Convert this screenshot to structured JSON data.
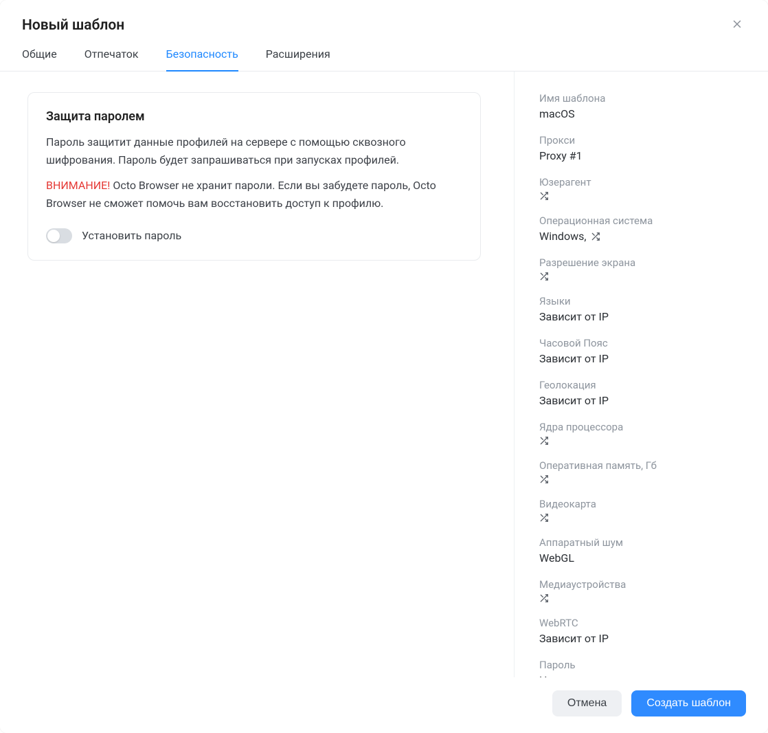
{
  "header": {
    "title": "Новый шаблон"
  },
  "tabs": [
    {
      "label": "Общие",
      "active": false
    },
    {
      "label": "Отпечаток",
      "active": false
    },
    {
      "label": "Безопасность",
      "active": true
    },
    {
      "label": "Расширения",
      "active": false
    }
  ],
  "security_card": {
    "title": "Защита паролем",
    "description": "Пароль защитит данные профилей на сервере с помощью сквозного шифрования. Пароль будет запрашиваться при запусках профилей.",
    "warning_prefix": "ВНИМАНИЕ!",
    "warning_text": " Octo Browser не хранит пароли. Если вы забудете пароль, Octo Browser не сможет помочь вам восстановить доступ к профилю.",
    "toggle_label": "Установить пароль",
    "toggle_on": false
  },
  "summary": {
    "items": [
      {
        "label": "Имя шаблона",
        "value": "macOS",
        "shuffle": false
      },
      {
        "label": "Прокси",
        "value": "Proxy #1",
        "shuffle": false
      },
      {
        "label": "Юзерагент",
        "value": "",
        "shuffle": true
      },
      {
        "label": "Операционная система",
        "value": "Windows, ",
        "shuffle": true,
        "inline_shuffle": true
      },
      {
        "label": "Разрешение экрана",
        "value": "",
        "shuffle": true
      },
      {
        "label": "Языки",
        "value": "Зависит от IP",
        "shuffle": false
      },
      {
        "label": "Часовой Пояс",
        "value": "Зависит от IP",
        "shuffle": false
      },
      {
        "label": "Геолокация",
        "value": "Зависит от IP",
        "shuffle": false
      },
      {
        "label": "Ядра процессора",
        "value": "",
        "shuffle": true
      },
      {
        "label": "Оперативная память, Гб",
        "value": "",
        "shuffle": true
      },
      {
        "label": "Видеокарта",
        "value": "",
        "shuffle": true
      },
      {
        "label": "Аппаратный шум",
        "value": "WebGL",
        "shuffle": false
      },
      {
        "label": "Медиаустройства",
        "value": "",
        "shuffle": true
      },
      {
        "label": "WebRTC",
        "value": "Зависит от IP",
        "shuffle": false
      },
      {
        "label": "Пароль",
        "value": "Нет",
        "shuffle": false
      }
    ]
  },
  "footer": {
    "cancel": "Отмена",
    "create": "Создать шаблон"
  }
}
